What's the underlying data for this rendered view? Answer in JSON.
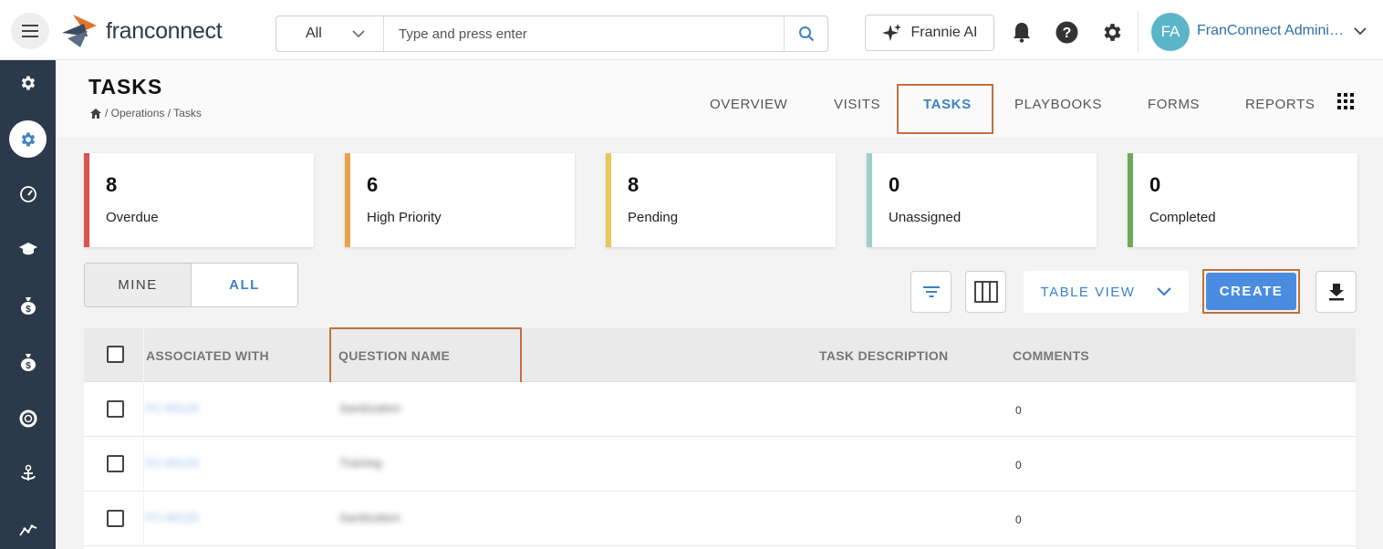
{
  "header": {
    "logo_text": "franconnect",
    "search": {
      "scope": "All",
      "placeholder": "Type and press enter"
    },
    "frannie_label": "Frannie AI",
    "user": {
      "initials": "FA",
      "name": "FranConnect Administrator"
    }
  },
  "page": {
    "title": "TASKS",
    "breadcrumb": [
      "/ Operations / Tasks"
    ]
  },
  "tabs": [
    {
      "label": "OVERVIEW",
      "active": false
    },
    {
      "label": "VISITS",
      "active": false
    },
    {
      "label": "TASKS",
      "active": true
    },
    {
      "label": "PLAYBOOKS",
      "active": false
    },
    {
      "label": "FORMS",
      "active": false
    },
    {
      "label": "REPORTS",
      "active": false
    }
  ],
  "stats": [
    {
      "value": "8",
      "label": "Overdue",
      "color": "#d9534f"
    },
    {
      "value": "6",
      "label": "High Priority",
      "color": "#e8a24a"
    },
    {
      "value": "8",
      "label": "Pending",
      "color": "#e9c85a"
    },
    {
      "value": "0",
      "label": "Unassigned",
      "color": "#9ed0c9"
    },
    {
      "value": "0",
      "label": "Completed",
      "color": "#6ea85a"
    }
  ],
  "filter": {
    "mine": "MINE",
    "all": "ALL"
  },
  "toolbar": {
    "table_view": "TABLE VIEW",
    "create": "CREATE"
  },
  "table": {
    "columns": [
      "ASSOCIATED WITH",
      "QUESTION NAME",
      "TASK DESCRIPTION",
      "COMMENTS"
    ],
    "rows": [
      {
        "associated": "FC-00123",
        "question": "Sanitization",
        "comments": "0"
      },
      {
        "associated": "FC-00124",
        "question": "Training",
        "comments": "0"
      },
      {
        "associated": "FC-00125",
        "question": "Sanitization",
        "comments": "0"
      }
    ]
  },
  "colors": {
    "accent": "#3b82c4",
    "sidebar": "#2b3a4a",
    "create": "#4a8ce0",
    "highlight": "#c0703f"
  }
}
